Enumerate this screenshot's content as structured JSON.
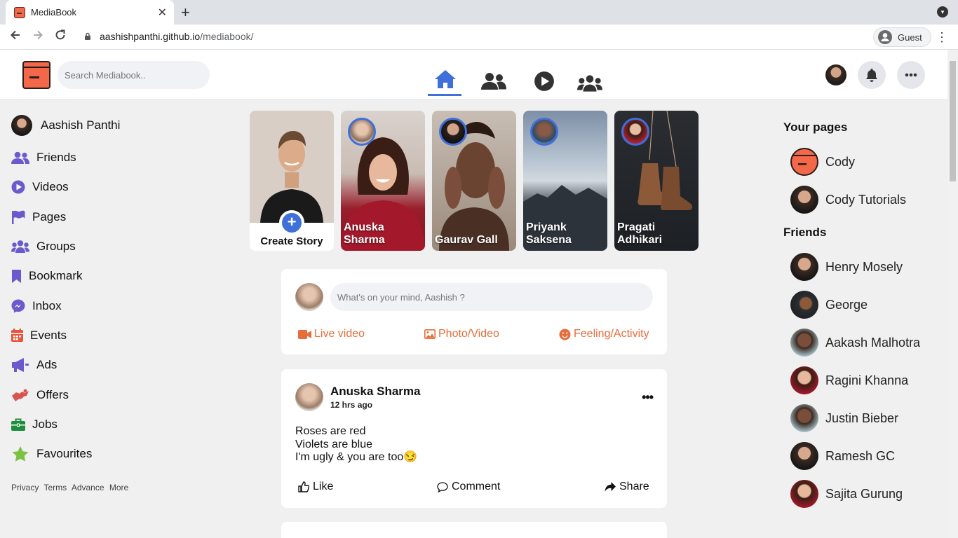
{
  "browser": {
    "tab_title": "MediaBook",
    "tab_close": "✕",
    "new_tab": "+",
    "url_host": "aashishpanthi.github.io",
    "url_path": "/mediabook/",
    "profile_label": "Guest"
  },
  "header": {
    "search_placeholder": "Search Mediabook..",
    "nav": [
      "home-icon",
      "friends-icon",
      "watch-icon",
      "groups-icon"
    ],
    "accent_color": "#3f6fd8"
  },
  "sidebar": {
    "profile_name": "Aashish Panthi",
    "items": [
      {
        "label": "Friends",
        "icon": "friends-icon"
      },
      {
        "label": "Videos",
        "icon": "play-icon"
      },
      {
        "label": "Pages",
        "icon": "flag-icon"
      },
      {
        "label": "Groups",
        "icon": "groups-icon"
      },
      {
        "label": "Bookmark",
        "icon": "bookmark-icon"
      },
      {
        "label": "Inbox",
        "icon": "messenger-icon"
      },
      {
        "label": "Events",
        "icon": "calendar-icon"
      },
      {
        "label": "Ads",
        "icon": "megaphone-icon"
      },
      {
        "label": "Offers",
        "icon": "offer-icon"
      },
      {
        "label": "Jobs",
        "icon": "briefcase-icon"
      },
      {
        "label": "Favourites",
        "icon": "star-icon"
      }
    ],
    "footer": [
      "Privacy",
      "Terms",
      "Advance",
      "More"
    ]
  },
  "stories": {
    "create_label": "Create Story",
    "create_plus": "+",
    "items": [
      {
        "name_line1": "Anuska",
        "name_line2": "Sharma"
      },
      {
        "name_line1": "Gaurav Gall",
        "name_line2": ""
      },
      {
        "name_line1": "Priyank",
        "name_line2": "Saksena"
      },
      {
        "name_line1": "Pragati",
        "name_line2": "Adhikari"
      }
    ]
  },
  "composer": {
    "placeholder": "What's on your mind, Aashish ?",
    "live_video": "Live video",
    "photo_video": "Photo/Video",
    "feeling": "Feeling/Activity",
    "action_color": "#e86d3a"
  },
  "post": {
    "author": "Anuska Sharma",
    "time": "12 hrs ago",
    "more": "•••",
    "line1": "Roses are red",
    "line2": "Violets are blue",
    "line3": "I'm ugly & you are too😏",
    "like": "Like",
    "comment": "Comment",
    "share": "Share"
  },
  "rightbar": {
    "pages_heading": "Your pages",
    "pages": [
      "Cody",
      "Cody Tutorials"
    ],
    "friends_heading": "Friends",
    "friends": [
      "Henry Mosely",
      "George",
      "Aakash Malhotra",
      "Ragini Khanna",
      "Justin Bieber",
      "Ramesh GC",
      "Sajita Gurung"
    ]
  }
}
